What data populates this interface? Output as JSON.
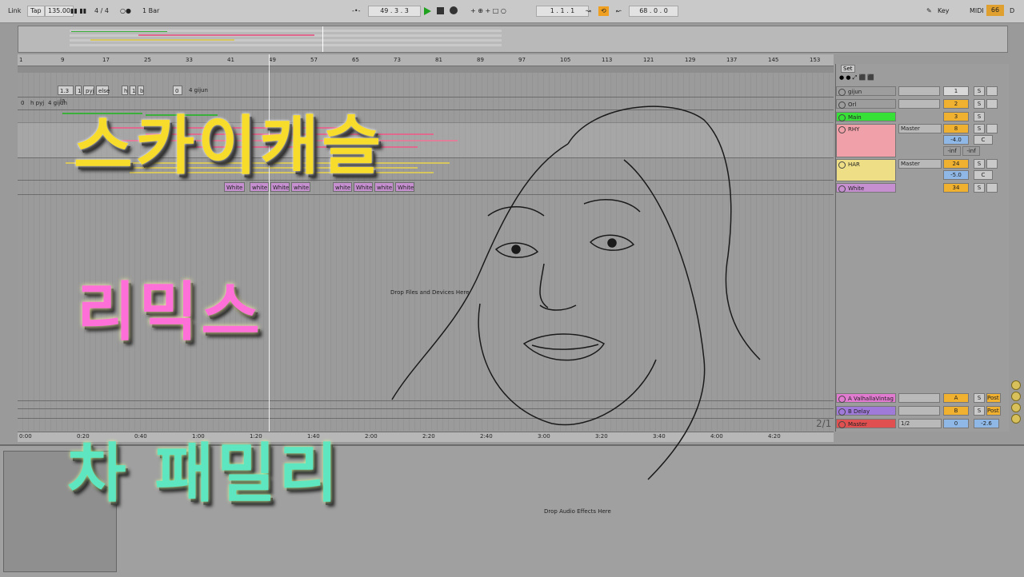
{
  "transport": {
    "link": "Link",
    "tap": "Tap",
    "tempo": "135.00",
    "signature": "4 / 4",
    "metronome": "○●",
    "quantize": "1 Bar",
    "position": "49 . 3 . 3",
    "loop_start": "1 . 1 . 1",
    "loop_length": "68 . 0 . 0",
    "key": "Key",
    "midi": "MIDI",
    "cpu": "66"
  },
  "ruler": {
    "bars": [
      "1",
      "9",
      "17",
      "25",
      "33",
      "41",
      "49",
      "57",
      "65",
      "73",
      "81",
      "89",
      "97",
      "105",
      "113",
      "121",
      "129",
      "137",
      "145",
      "153"
    ]
  },
  "time_ruler": {
    "times": [
      "0:00",
      "0:20",
      "0:40",
      "1:00",
      "1:20",
      "1:40",
      "2:00",
      "2:20",
      "2:40",
      "3:00",
      "3:20",
      "3:40",
      "4:00",
      "4:20"
    ]
  },
  "clips": {
    "top_row": [
      "1.3 ja",
      "1",
      "pyj",
      "else",
      "h",
      "1",
      "b",
      "0",
      "4 gijun"
    ],
    "second_row": [
      "0",
      "h pyj",
      "4 gijun"
    ],
    "white_clips": [
      "White",
      "white",
      "White",
      "white",
      "white",
      "White",
      "white",
      "White"
    ]
  },
  "drop_files": "Drop Files and Devices Here",
  "drop_audio": "Drop Audio Effects Here",
  "page_indicator": "2/1",
  "mixer": {
    "set_label": "Set",
    "tracks": [
      {
        "name": "gijun",
        "num": "1",
        "color": "#b0b0b0",
        "num_color": "#d8d8d8"
      },
      {
        "name": "Orl",
        "num": "2",
        "color": "#b0b0b0",
        "num_color": "#f0b030"
      },
      {
        "name": "Main",
        "num": "3",
        "color": "#37e037",
        "num_color": "#f0b030"
      },
      {
        "name": "RHY",
        "num": "8",
        "color": "#f0a0a8",
        "num_color": "#f0b030",
        "route": "Master",
        "vol": "-4.0",
        "pan": "C",
        "inf1": "-inf",
        "inf2": "-inf"
      },
      {
        "name": "HAR",
        "num": "24",
        "color": "#eedf86",
        "num_color": "#f0b030",
        "route": "Master",
        "vol": "-5.0",
        "pan": "C"
      },
      {
        "name": "White",
        "num": "34",
        "color": "#c58fd0",
        "num_color": "#f0b030"
      }
    ],
    "returns": [
      {
        "name": "A ValhallaVintag",
        "num": "A",
        "post": "Post",
        "color": "#e07bd0"
      },
      {
        "name": "B Delay",
        "num": "B",
        "post": "Post",
        "color": "#9f7ad8"
      }
    ],
    "master": {
      "name": "Master",
      "route": "1/2",
      "num": "0",
      "vol": "-2.6",
      "color": "#e05050"
    },
    "solo_label": "S"
  },
  "overlay": {
    "line1": "스카이캐슬",
    "line2": "리믹스",
    "line3": "차 패밀리"
  },
  "colors": {
    "line1": "#f7dc2b",
    "line2": "#ff6fd8",
    "line3": "#5ee6c0",
    "play": "#1ea21e",
    "clip_white": "#c58fd0",
    "rhy": "#f0a0a8",
    "har": "#eedf86",
    "main": "#37e037"
  }
}
